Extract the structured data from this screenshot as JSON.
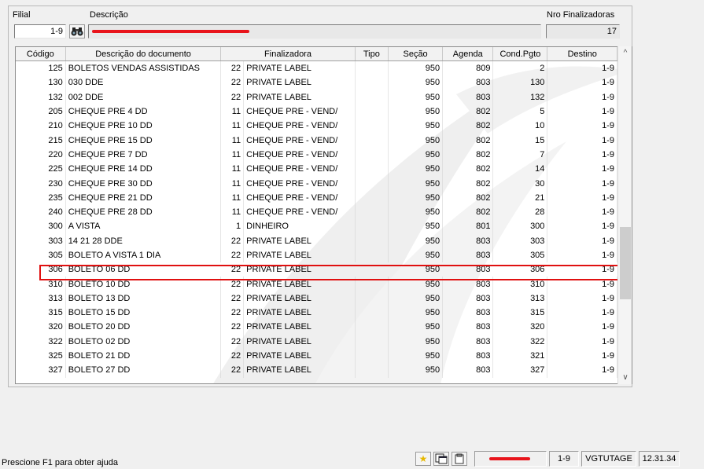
{
  "header": {
    "filial_label": "Filial",
    "filial_value": "1-9",
    "descricao_label": "Descrição",
    "nro_label": "Nro Finalizadoras",
    "nro_value": "17"
  },
  "grid": {
    "columns": [
      "Código",
      "Descrição do documento",
      "Finalizadora",
      "Tipo",
      "Seção",
      "Agenda",
      "Cond.Pgto",
      "Destino"
    ],
    "rows": [
      [
        "125",
        "BOLETOS VENDAS ASSISTIDAS",
        "22",
        "PRIVATE LABEL",
        "",
        "950",
        "809",
        "2",
        "1-9"
      ],
      [
        "130",
        "030 DDE",
        "22",
        "PRIVATE LABEL",
        "",
        "950",
        "803",
        "130",
        "1-9"
      ],
      [
        "132",
        "002 DDE",
        "22",
        "PRIVATE LABEL",
        "",
        "950",
        "803",
        "132",
        "1-9"
      ],
      [
        "205",
        "CHEQUE PRE 4 DD",
        "11",
        "CHEQUE PRE - VEND/",
        "",
        "950",
        "802",
        "5",
        "1-9"
      ],
      [
        "210",
        "CHEQUE PRE 10 DD",
        "11",
        "CHEQUE PRE - VEND/",
        "",
        "950",
        "802",
        "10",
        "1-9"
      ],
      [
        "215",
        "CHEQUE PRE 15 DD",
        "11",
        "CHEQUE PRE - VEND/",
        "",
        "950",
        "802",
        "15",
        "1-9"
      ],
      [
        "220",
        "CHEQUE PRE 7 DD",
        "11",
        "CHEQUE PRE - VEND/",
        "",
        "950",
        "802",
        "7",
        "1-9"
      ],
      [
        "225",
        "CHEQUE PRE 14 DD",
        "11",
        "CHEQUE PRE - VEND/",
        "",
        "950",
        "802",
        "14",
        "1-9"
      ],
      [
        "230",
        "CHEQUE PRE 30 DD",
        "11",
        "CHEQUE PRE - VEND/",
        "",
        "950",
        "802",
        "30",
        "1-9"
      ],
      [
        "235",
        "CHEQUE PRE 21 DD",
        "11",
        "CHEQUE PRE - VEND/",
        "",
        "950",
        "802",
        "21",
        "1-9"
      ],
      [
        "240",
        "CHEQUE PRE 28 DD",
        "11",
        "CHEQUE PRE - VEND/",
        "",
        "950",
        "802",
        "28",
        "1-9"
      ],
      [
        "300",
        "A VISTA",
        "1",
        "DINHEIRO",
        "",
        "950",
        "801",
        "300",
        "1-9"
      ],
      [
        "303",
        "14 21 28 DDE",
        "22",
        "PRIVATE LABEL",
        "",
        "950",
        "803",
        "303",
        "1-9"
      ],
      [
        "305",
        "BOLETO A VISTA 1 DIA",
        "22",
        "PRIVATE LABEL",
        "",
        "950",
        "803",
        "305",
        "1-9"
      ],
      [
        "306",
        "BOLETO 06 DD",
        "22",
        "PRIVATE LABEL",
        "",
        "950",
        "803",
        "306",
        "1-9"
      ],
      [
        "310",
        "BOLETO 10 DD",
        "22",
        "PRIVATE LABEL",
        "",
        "950",
        "803",
        "310",
        "1-9"
      ],
      [
        "313",
        "BOLETO 13 DD",
        "22",
        "PRIVATE LABEL",
        "",
        "950",
        "803",
        "313",
        "1-9"
      ],
      [
        "315",
        "BOLETO 15 DD",
        "22",
        "PRIVATE LABEL",
        "",
        "950",
        "803",
        "315",
        "1-9"
      ],
      [
        "320",
        "BOLETO 20 DD",
        "22",
        "PRIVATE LABEL",
        "",
        "950",
        "803",
        "320",
        "1-9"
      ],
      [
        "322",
        "BOLETO 02 DD",
        "22",
        "PRIVATE LABEL",
        "",
        "950",
        "803",
        "322",
        "1-9"
      ],
      [
        "325",
        "BOLETO 21 DD",
        "22",
        "PRIVATE LABEL",
        "",
        "950",
        "803",
        "321",
        "1-9"
      ],
      [
        "327",
        "BOLETO 27 DD",
        "22",
        "PRIVATE LABEL",
        "",
        "950",
        "803",
        "327",
        "1-9"
      ]
    ],
    "highlighted_row_codigo": "306"
  },
  "status": {
    "help_text": "Prescione F1 para obter ajuda",
    "icons": [
      "star-icon",
      "window-icon",
      "clipboard-icon"
    ],
    "filial": "1-9",
    "user": "VGTUTAGE",
    "time": "12.31.34"
  },
  "colors": {
    "highlight_border": "#e01010",
    "redaction": "#e8141b"
  }
}
